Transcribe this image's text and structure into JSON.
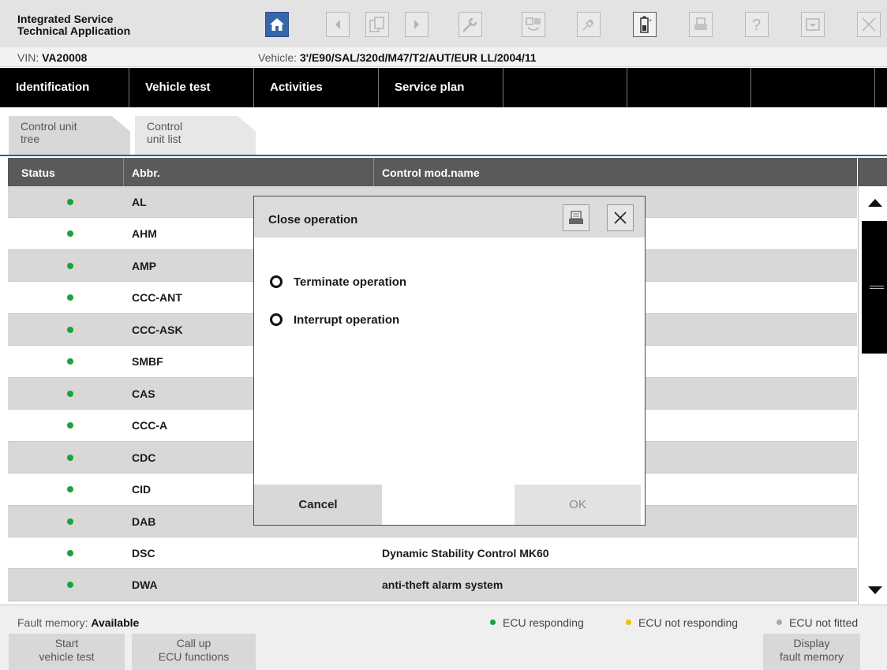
{
  "app": {
    "title_line1": "Integrated Service",
    "title_line2": "Technical Application"
  },
  "toolbar": {
    "icons": [
      "home-icon",
      "back-icon",
      "copy-icon",
      "forward-icon",
      "wrench-icon",
      "vehicle-connect-icon",
      "plug-icon",
      "battery-icon",
      "print-icon",
      "help-icon",
      "minimize-icon",
      "close-icon"
    ]
  },
  "vehicle": {
    "vin_label": "VIN:",
    "vin": "VA20008",
    "vehicle_label": "Vehicle:",
    "vehicle": "3'/E90/SAL/320d/M47/T2/AUT/EUR LL/2004/11"
  },
  "nav": {
    "tabs": [
      "Identification",
      "Vehicle test",
      "Activities",
      "Service plan"
    ]
  },
  "subtabs": {
    "tree_line1": "Control unit",
    "tree_line2": "tree",
    "list_line1": "Control",
    "list_line2": "unit list"
  },
  "table": {
    "col_status": "Status",
    "col_abbr": "Abbr.",
    "col_name": "Control mod.name",
    "rows": [
      {
        "abbr": "AL",
        "name": ""
      },
      {
        "abbr": "AHM",
        "name": ""
      },
      {
        "abbr": "AMP",
        "name": ""
      },
      {
        "abbr": "CCC-ANT",
        "name": ""
      },
      {
        "abbr": "CCC-ASK",
        "name": ""
      },
      {
        "abbr": "SMBF",
        "name": ""
      },
      {
        "abbr": "CAS",
        "name": ""
      },
      {
        "abbr": "CCC-A",
        "name": ""
      },
      {
        "abbr": "CDC",
        "name": ""
      },
      {
        "abbr": "CID",
        "name": ""
      },
      {
        "abbr": "DAB",
        "name": ""
      },
      {
        "abbr": "DSC",
        "name": "Dynamic Stability Control MK60"
      },
      {
        "abbr": "DWA",
        "name": "anti-theft alarm system"
      }
    ]
  },
  "footer": {
    "fault_label": "Fault memory:",
    "fault_value": "Available",
    "legend_responding": "ECU responding",
    "legend_not_responding": "ECU not responding",
    "legend_not_fitted": "ECU not fitted",
    "btn_start_1": "Start",
    "btn_start_2": "vehicle test",
    "btn_call_1": "Call up",
    "btn_call_2": "ECU functions",
    "btn_display_1": "Display",
    "btn_display_2": "fault memory"
  },
  "colors": {
    "responding": "#1aa33a",
    "not_responding": "#f2c200",
    "not_fitted": "#a8a8a8",
    "accent": "#3766a9"
  },
  "dialog": {
    "title": "Close operation",
    "option_terminate": "Terminate operation",
    "option_interrupt": "Interrupt operation",
    "cancel": "Cancel",
    "ok": "OK"
  }
}
